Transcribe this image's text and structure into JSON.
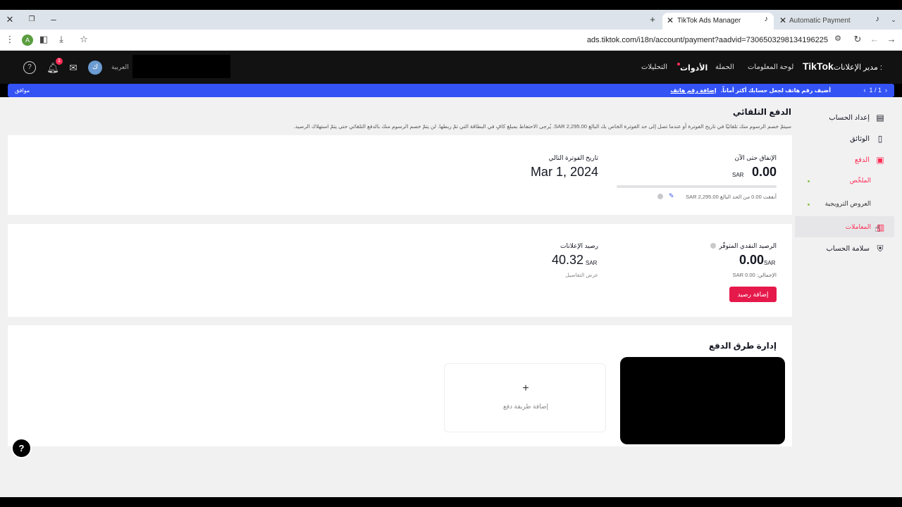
{
  "browser": {
    "tabs": [
      {
        "title": "TikTok Ads Manager",
        "active": true
      },
      {
        "title": "Automatic Payment",
        "active": false
      }
    ],
    "url": "ads.tiktok.com/i18n/account/payment?aadvid=7306503298134196225",
    "profile_initial": "A"
  },
  "header": {
    "logo": "TikTok",
    "logo_sub": "مدير الإعلانات :",
    "nav": [
      "لوحة المعلومات",
      "الحملة",
      "الأدوات",
      "التحليلات"
    ],
    "active_nav": "الأدوات",
    "notification_count": "1",
    "user_initial": "ك",
    "language": "العربية"
  },
  "banner": {
    "message": "أضيف رقم هاتف لجعل حسابك أكثر أماناً.",
    "link": "إضافة رقم هاتف",
    "ok": "موافق",
    "pager": "1 / 1"
  },
  "sidebar": {
    "items": [
      {
        "label": "إعداد الحساب",
        "icon": "id-card-icon"
      },
      {
        "label": "الوثائق",
        "icon": "document-icon"
      },
      {
        "label": "الدفع",
        "icon": "wallet-icon"
      },
      {
        "label": "الملخّص",
        "sub": true
      },
      {
        "label": "العروض الترويجية",
        "sub": true
      },
      {
        "label": "المعاملات",
        "sub": true
      },
      {
        "label": "سلامة الحساب",
        "icon": "shield-icon"
      }
    ]
  },
  "main": {
    "title": "الدفع التلقائي",
    "description": "سيتمّ خصم الرسوم منك تلقائيًا في تاريخ الفوترة أو عندما تصل إلى حد الفوترة الخاص بك البالغ SAR 2,295.00. يُرجى الاحتفاظ بمبلغ كافٍ في البطاقة التي تمّ ربطها. لن يتمّ خصم الرسوم منك بالدفع التلقائي حتى يتمّ استهلاك الرصيد.",
    "spend": {
      "label": "الإنفاق حتى الآن",
      "value": "0.00",
      "currency": "SAR",
      "progress": 0,
      "note": "أنفقت 0.00 من الحد البالغ SAR 2,295.00"
    },
    "next_invoice": {
      "label": "تاريخ الفوترة التالي",
      "date": "Mar 1, 2024"
    },
    "cash_balance": {
      "label": "الرصيد النقدي المتوفّر",
      "value": "0.00",
      "currency": "SAR",
      "total": "الإجمالي: SAR 0.00",
      "button": "إضافة رصيد"
    },
    "ad_credit": {
      "label": "رصيد الإعلانات",
      "value": "40.32",
      "currency": "SAR",
      "link": "عرض التفاصيل"
    },
    "payment_methods": {
      "title": "إدارة طرق الدفع",
      "add_label": "إضافة طريقة دفع"
    }
  }
}
